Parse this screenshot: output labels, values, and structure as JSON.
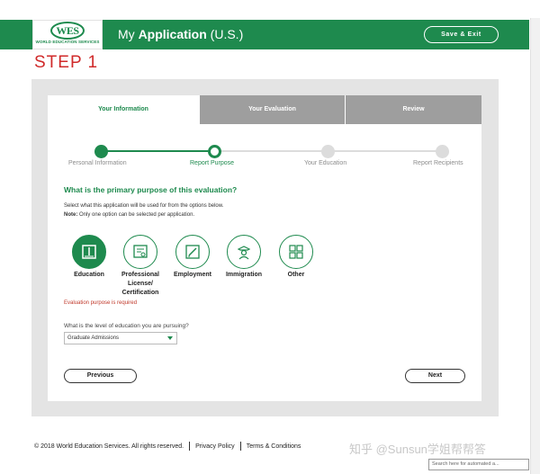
{
  "header": {
    "logo_text": "WES",
    "logo_subtext": "WORLD EDUCATION SERVICES",
    "title_prefix": "My ",
    "title_bold": "Application",
    "title_suffix": " (U.S.)",
    "save_exit_label": "Save & Exit"
  },
  "step_label": "STEP 1",
  "tabs": [
    {
      "label": "Your Information",
      "active": true
    },
    {
      "label": "Your Evaluation",
      "active": false
    },
    {
      "label": "Review",
      "active": false
    }
  ],
  "progress": {
    "steps": [
      "Personal Information",
      "Report Purpose",
      "Your Education",
      "Report Recipients"
    ],
    "current_index": 1,
    "accent": "#1e8a4e"
  },
  "question": "What is the primary purpose of this evaluation?",
  "instruction": "Select what this application will be used for from the options below.",
  "note_bold": "Note:",
  "note_text": " Only one option can be selected per application.",
  "options": [
    {
      "label": "Education",
      "icon": "book-icon",
      "selected": true
    },
    {
      "label": "Professional License/ Certification",
      "icon": "certificate-icon",
      "selected": false
    },
    {
      "label": "Employment",
      "icon": "pencil-icon",
      "selected": false
    },
    {
      "label": "Immigration",
      "icon": "officer-icon",
      "selected": false
    },
    {
      "label": "Other",
      "icon": "grid-icon",
      "selected": false
    }
  ],
  "error_text": "Evaluation purpose is required",
  "level_question": "What is the level of education you are pursuing?",
  "level_select_value": "Graduate Admissions",
  "previous_label": "Previous",
  "next_label": "Next",
  "footer": {
    "copyright": "© 2018 World Education Services. All rights reserved.",
    "privacy": "Privacy Policy",
    "terms": "Terms & Conditions"
  },
  "watermark": "知乎 @Sunsun学姐帮帮答",
  "search_placeholder": "Search here for automated a..."
}
